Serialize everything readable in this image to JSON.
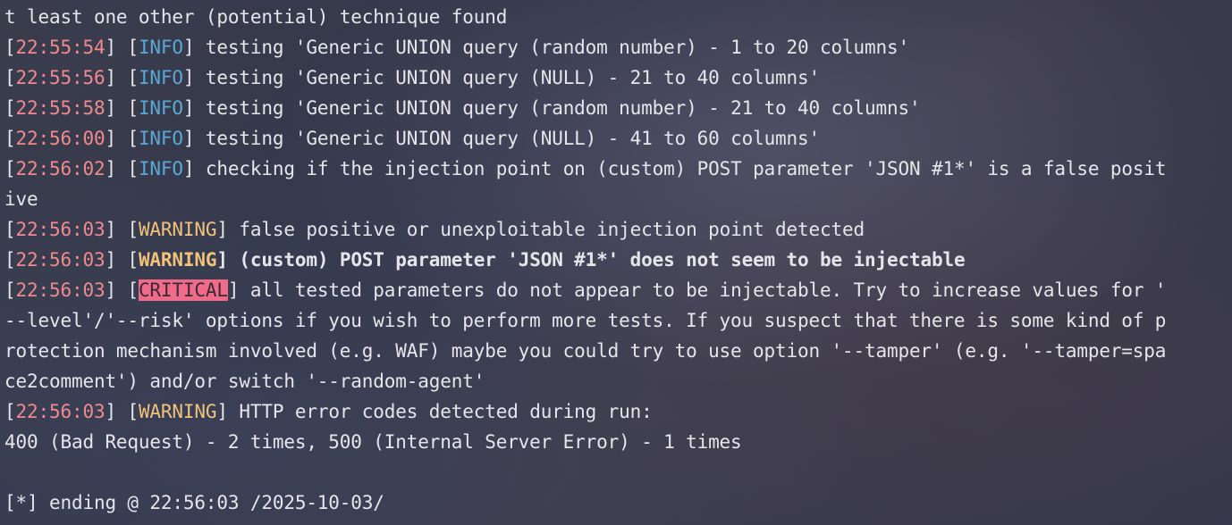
{
  "colors": {
    "timestamp": "#f08a8e",
    "info": "#5aa8d6",
    "warning": "#f0c27a",
    "critical_bg": "#f06b8a",
    "text": "#e6e6ea"
  },
  "lines": [
    {
      "text": "t least one other (potential) technique found"
    },
    {
      "time": "22:55:54",
      "level": "INFO",
      "msg": " testing 'Generic UNION query (random number) - 1 to 20 columns'"
    },
    {
      "time": "22:55:56",
      "level": "INFO",
      "msg": " testing 'Generic UNION query (NULL) - 21 to 40 columns'"
    },
    {
      "time": "22:55:58",
      "level": "INFO",
      "msg": " testing 'Generic UNION query (random number) - 21 to 40 columns'"
    },
    {
      "time": "22:56:00",
      "level": "INFO",
      "msg": " testing 'Generic UNION query (NULL) - 41 to 60 columns'"
    },
    {
      "time": "22:56:02",
      "level": "INFO",
      "msg": " checking if the injection point on (custom) POST parameter 'JSON #1*' is a false posit"
    },
    {
      "text": "ive"
    },
    {
      "time": "22:56:03",
      "level": "WARNING",
      "msg": " false positive or unexploitable injection point detected"
    },
    {
      "time": "22:56:03",
      "level": "WARNING",
      "msg": " (custom) POST parameter 'JSON #1*' does not seem to be injectable"
    },
    {
      "time": "22:56:03",
      "level": "CRITICAL",
      "msg": " all tested parameters do not appear to be injectable. Try to increase values for '"
    },
    {
      "text": "--level'/'--risk' options if you wish to perform more tests. If you suspect that there is some kind of p"
    },
    {
      "text": "rotection mechanism involved (e.g. WAF) maybe you could try to use option '--tamper' (e.g. '--tamper=spa"
    },
    {
      "text": "ce2comment') and/or switch '--random-agent'"
    },
    {
      "time": "22:56:03",
      "level": "WARNING",
      "msg": " HTTP error codes detected during run:"
    },
    {
      "text": "400 (Bad Request) - 2 times, 500 (Internal Server Error) - 1 times"
    },
    {
      "text": ""
    },
    {
      "text": "[*] ending @ 22:56:03 /2025-10-03/"
    }
  ]
}
